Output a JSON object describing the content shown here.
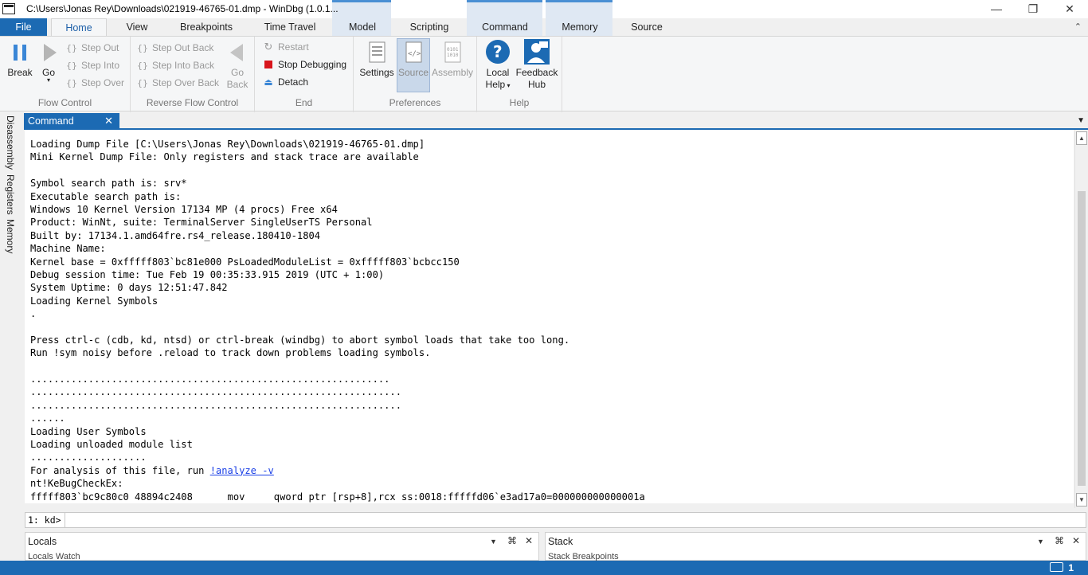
{
  "window": {
    "title": "C:\\Users\\Jonas Rey\\Downloads\\021919-46765-01.dmp - WinDbg (1.0.1...",
    "minimize": "—",
    "maximize": "❐",
    "close": "✕"
  },
  "tabs": {
    "file": "File",
    "home": "Home",
    "view": "View",
    "breakpoints": "Breakpoints",
    "time_travel": "Time Travel",
    "model": "Model",
    "scripting": "Scripting",
    "command": "Command",
    "memory": "Memory",
    "source": "Source",
    "collapse_icon": "chevron-up-icon"
  },
  "ribbon": {
    "flow_control": {
      "label": "Flow Control",
      "break": "Break",
      "go": "Go",
      "step_out": "Step Out",
      "step_into": "Step Into",
      "step_over": "Step Over"
    },
    "reverse_flow_control": {
      "label": "Reverse Flow Control",
      "step_out_back": "Step Out Back",
      "step_into_back": "Step Into Back",
      "step_over_back": "Step Over Back",
      "go_back_1": "Go",
      "go_back_2": "Back"
    },
    "end": {
      "label": "End",
      "restart": "Restart",
      "stop_debugging": "Stop Debugging",
      "detach": "Detach"
    },
    "preferences": {
      "label": "Preferences",
      "settings": "Settings",
      "source": "Source",
      "assembly": "Assembly"
    },
    "help": {
      "label": "Help",
      "local_help_1": "Local",
      "local_help_2": "Help",
      "feedback_1": "Feedback",
      "feedback_2": "Hub"
    }
  },
  "side_tabs": [
    "Disassembly",
    "Registers",
    "Memory"
  ],
  "command_window": {
    "title": "Command",
    "close": "✕",
    "output_lines": [
      "Loading Dump File [C:\\Users\\Jonas Rey\\Downloads\\021919-46765-01.dmp]",
      "Mini Kernel Dump File: Only registers and stack trace are available",
      "",
      "Symbol search path is: srv*",
      "Executable search path is:",
      "Windows 10 Kernel Version 17134 MP (4 procs) Free x64",
      "Product: WinNt, suite: TerminalServer SingleUserTS Personal",
      "Built by: 17134.1.amd64fre.rs4_release.180410-1804",
      "Machine Name:",
      "Kernel base = 0xfffff803`bc81e000 PsLoadedModuleList = 0xfffff803`bcbcc150",
      "Debug session time: Tue Feb 19 00:35:33.915 2019 (UTC + 1:00)",
      "System Uptime: 0 days 12:51:47.842",
      "Loading Kernel Symbols",
      ".",
      "",
      "Press ctrl-c (cdb, kd, ntsd) or ctrl-break (windbg) to abort symbol loads that take too long.",
      "Run !sym noisy before .reload to track down problems loading symbols.",
      "",
      "..............................................................",
      "................................................................",
      "................................................................",
      "......",
      "Loading User Symbols",
      "Loading unloaded module list",
      "...................."
    ],
    "analysis_prefix": "For analysis of this file, run ",
    "analysis_link": "!analyze -v",
    "after_lines": [
      "nt!KeBugCheckEx:",
      "fffff803`bc9c80c0 48894c2408      mov     qword ptr [rsp+8],rcx ss:0018:fffffd06`e3ad17a0=000000000000001a"
    ],
    "prompt": "1: kd>",
    "input_value": ""
  },
  "bottom_panes": {
    "locals": "Locals",
    "stack": "Stack",
    "locals_subtabs": "Locals   Watch",
    "stack_subtabs": "Stack   Breakpoints"
  },
  "status": {
    "notifications": "1"
  },
  "colors": {
    "accent": "#1c6ab3",
    "link": "#1a3fe6",
    "stop": "#d8151c"
  }
}
